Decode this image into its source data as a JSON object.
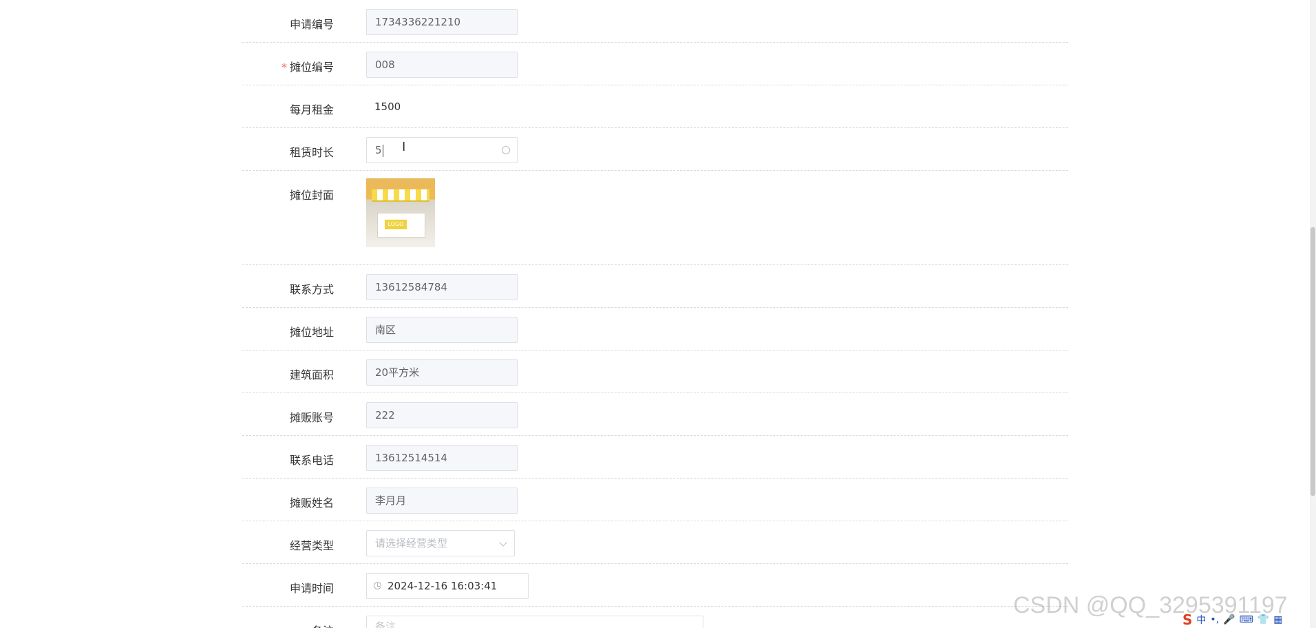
{
  "form": {
    "application_number": {
      "label": "申请编号",
      "value": "1734336221210"
    },
    "stall_number": {
      "label": "摊位编号",
      "required_mark": "*",
      "value": "008"
    },
    "monthly_rent": {
      "label": "每月租金",
      "value": "1500"
    },
    "lease_duration": {
      "label": "租赁时长",
      "value": "5"
    },
    "stall_cover": {
      "label": "摊位封面",
      "logo_text": "LOGO"
    },
    "contact_method": {
      "label": "联系方式",
      "value": "13612584784"
    },
    "stall_address": {
      "label": "摊位地址",
      "value": "南区"
    },
    "floor_area": {
      "label": "建筑面积",
      "value": "20平方米"
    },
    "vendor_account": {
      "label": "摊贩账号",
      "value": "222"
    },
    "contact_phone": {
      "label": "联系电话",
      "value": "13612514514"
    },
    "vendor_name": {
      "label": "摊贩姓名",
      "value": "李月月"
    },
    "business_type": {
      "label": "经营类型",
      "placeholder": "请选择经营类型"
    },
    "application_time": {
      "label": "申请时间",
      "value": "2024-12-16 16:03:41"
    },
    "remarks": {
      "label": "备注",
      "placeholder": "备注"
    }
  },
  "watermark": "CSDN @QQ_3295391197",
  "ime": {
    "logo": "S",
    "mode": "中"
  },
  "colors": {
    "required": "#f56c6c",
    "border": "#dcdfe6",
    "disabled_bg": "#f5f7fa"
  }
}
